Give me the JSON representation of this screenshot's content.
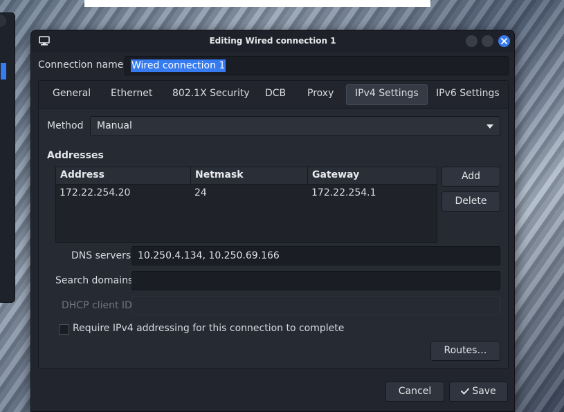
{
  "window": {
    "title": "Editing Wired connection 1"
  },
  "connection": {
    "name_label": "Connection name",
    "name_value": "Wired connection 1"
  },
  "tabs": [
    {
      "label": "General"
    },
    {
      "label": "Ethernet"
    },
    {
      "label": "802.1X Security"
    },
    {
      "label": "DCB"
    },
    {
      "label": "Proxy"
    },
    {
      "label": "IPv4 Settings",
      "active": true
    },
    {
      "label": "IPv6 Settings"
    }
  ],
  "ipv4": {
    "method_label": "Method",
    "method_value": "Manual",
    "addresses_title": "Addresses",
    "columns": [
      "Address",
      "Netmask",
      "Gateway"
    ],
    "rows": [
      [
        "172.22.254.20",
        "24",
        "172.22.254.1"
      ]
    ],
    "add_label": "Add",
    "delete_label": "Delete",
    "dns_label": "DNS servers",
    "dns_value": "10.250.4.134, 10.250.69.166",
    "search_label": "Search domains",
    "search_value": "",
    "dhcp_label": "DHCP client ID",
    "dhcp_value": "",
    "require_label": "Require IPv4 addressing for this connection to complete",
    "require_checked": false,
    "routes_label": "Routes…"
  },
  "footer": {
    "cancel_label": "Cancel",
    "save_label": "Save"
  },
  "colors": {
    "accent": "#367bf0",
    "dialog_bg": "#22252d"
  }
}
